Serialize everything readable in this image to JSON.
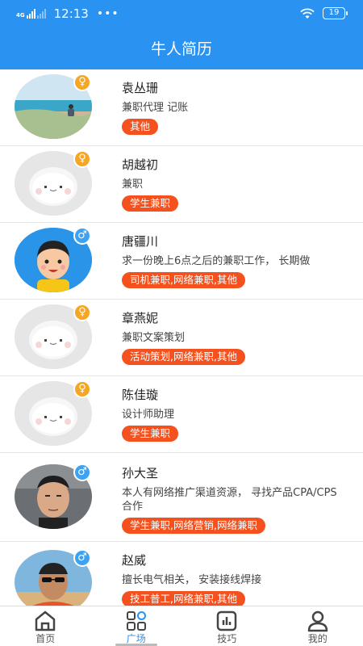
{
  "status": {
    "network": "4G",
    "time": "12:13",
    "dots": "•••",
    "battery": "19"
  },
  "header": {
    "title": "牛人简历"
  },
  "resumes": [
    {
      "name": "袁丛珊",
      "gender": "♀",
      "desc": "兼职代理 记账",
      "tags": "其他",
      "avatar": "photo-seaside-avatar"
    },
    {
      "name": "胡越初",
      "gender": "♀",
      "desc": "兼职",
      "tags": "学生兼职",
      "avatar": "default-avatar"
    },
    {
      "name": "唐疆川",
      "gender": "♂",
      "desc": "求一份晚上6点之后的兼职工作，  长期做",
      "tags": "司机兼职,网络兼职,其他",
      "avatar": "cartoon-boy-avatar"
    },
    {
      "name": "章燕妮",
      "gender": "♀",
      "desc": "兼职文案策划",
      "tags": "活动策划,网络兼职,其他",
      "avatar": "default-avatar"
    },
    {
      "name": "陈佳璇",
      "gender": "♀",
      "desc": "设计师助理",
      "tags": "学生兼职",
      "avatar": "default-avatar"
    },
    {
      "name": "孙大圣",
      "gender": "♂",
      "desc": "本人有网络推广渠道资源，  寻找产品CPA/CPS合作",
      "tags": "学生兼职,网络营销,网络兼职",
      "avatar": "photo-man-avatar"
    },
    {
      "name": "赵威",
      "gender": "♂",
      "desc": "擅长电气相关，  安装接线焊接",
      "tags": "技工普工,网络兼职,其他",
      "avatar": "photo-sunglasses-avatar"
    }
  ],
  "tabbar": [
    {
      "label": "首页",
      "icon": "home-icon"
    },
    {
      "label": "广场",
      "icon": "square-grid-icon"
    },
    {
      "label": "技巧",
      "icon": "chart-icon"
    },
    {
      "label": "我的",
      "icon": "user-icon"
    }
  ],
  "colors": {
    "primary": "#2a92f0",
    "tag": "#f4511e",
    "female": "#f5a623",
    "male": "#3ea2f3"
  }
}
